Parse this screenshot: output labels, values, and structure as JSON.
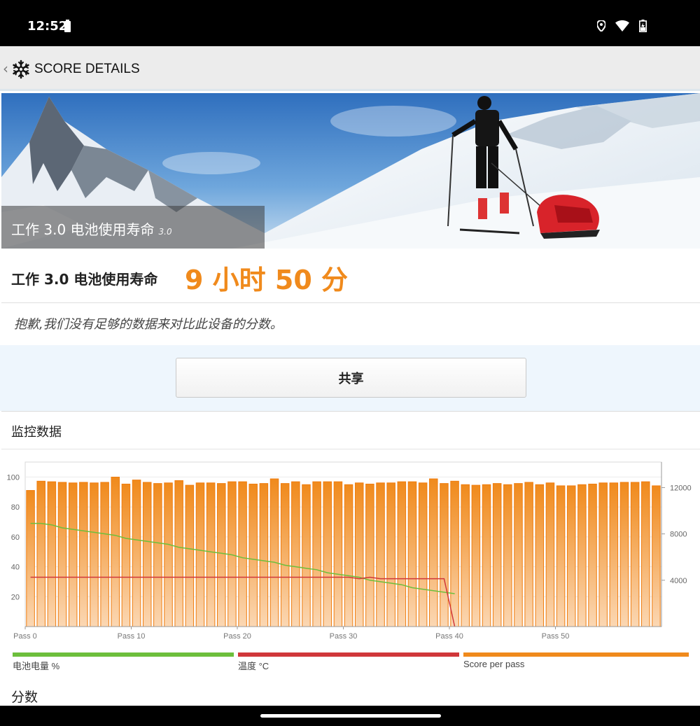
{
  "status": {
    "time": "12:52",
    "icons": [
      "location-icon",
      "wifi-icon",
      "battery-charging-icon"
    ]
  },
  "app_bar": {
    "title": "SCORE DETAILS",
    "back_icon": "chevron-left-icon",
    "logo_icon": "snowflake-icon"
  },
  "hero": {
    "caption": "工作 3.0 电池使用寿命",
    "version": "3.0"
  },
  "score": {
    "label": "工作 3.0 电池使用寿命",
    "value": "9 小时 50 分",
    "accent": "#f08a1c"
  },
  "notice": "抱歉,我们没有足够的数据来对比此设备的分数。",
  "share_label": "共享",
  "monitor": {
    "title": "监控数据"
  },
  "chart_data": {
    "type": "bar",
    "x": [
      0,
      1,
      2,
      3,
      4,
      5,
      6,
      7,
      8,
      9,
      10,
      11,
      12,
      13,
      14,
      15,
      16,
      17,
      18,
      19,
      20,
      21,
      22,
      23,
      24,
      25,
      26,
      27,
      28,
      29,
      30,
      31,
      32,
      33,
      34,
      35,
      36,
      37,
      38,
      39,
      40,
      41,
      42,
      43,
      44,
      45,
      46,
      47,
      48,
      49,
      50,
      51,
      52,
      53,
      54,
      55,
      56,
      57,
      58,
      59
    ],
    "x_ticks": [
      "Pass 0",
      "Pass 10",
      "Pass 20",
      "Pass 30",
      "Pass 40",
      "Pass 50"
    ],
    "y_left_ticks": [
      "20",
      "40",
      "60",
      "80",
      "100"
    ],
    "y_right_ticks": [
      "4000",
      "8000",
      "12000"
    ],
    "ylim_left": [
      0,
      110
    ],
    "ylim_right": [
      0,
      14200
    ],
    "series": [
      {
        "name": "Score per pass",
        "axis": "right",
        "color": "#f08a1c",
        "values": [
          11750,
          12550,
          12500,
          12450,
          12400,
          12450,
          12400,
          12450,
          12900,
          12300,
          12650,
          12450,
          12350,
          12400,
          12600,
          12200,
          12400,
          12400,
          12350,
          12500,
          12500,
          12300,
          12350,
          12750,
          12350,
          12500,
          12250,
          12500,
          12500,
          12500,
          12250,
          12400,
          12300,
          12400,
          12400,
          12500,
          12500,
          12400,
          12750,
          12350,
          12550,
          12250,
          12200,
          12250,
          12350,
          12250,
          12350,
          12450,
          12250,
          12400,
          12150,
          12150,
          12250,
          12300,
          12400,
          12400,
          12450,
          12450,
          12500,
          12150
        ]
      },
      {
        "name": "电池电量 %",
        "axis": "left",
        "color": "#6dbf3c",
        "values": [
          69,
          69,
          68,
          66,
          65,
          64,
          63,
          62,
          61,
          59,
          58,
          57,
          56,
          55,
          53,
          52,
          51,
          50,
          49,
          48,
          46,
          45,
          44,
          43,
          41,
          40,
          39,
          38,
          36,
          35,
          34,
          33,
          31,
          30,
          29,
          28,
          26,
          25,
          24,
          23,
          22
        ]
      },
      {
        "name": "温度 °C",
        "axis": "left",
        "color": "#d0373a",
        "values": [
          33,
          33,
          33,
          33,
          33,
          33,
          33,
          33,
          33,
          33,
          33,
          33,
          33,
          33,
          33,
          33,
          33,
          33,
          33,
          33,
          33,
          33,
          33,
          33,
          33,
          33,
          33,
          33,
          33,
          33,
          33,
          32,
          33,
          32,
          32,
          32,
          32,
          32,
          32,
          32,
          0
        ]
      }
    ],
    "grid": true
  },
  "legend": [
    {
      "label": "电池电量 %",
      "color": "#6dbf3c"
    },
    {
      "label": "温度 °C",
      "color": "#d0373a"
    },
    {
      "label": "Score per pass",
      "color": "#f08a1c"
    }
  ],
  "score_section_title": "分数"
}
